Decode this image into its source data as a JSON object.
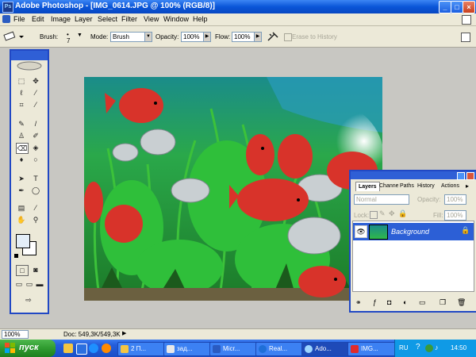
{
  "window": {
    "title": "Adobe Photoshop - [IMG_0614.JPG @ 100% (RGB/8)]",
    "controls": [
      "_",
      "□",
      "×"
    ]
  },
  "menu": [
    "File",
    "Edit",
    "Image",
    "Layer",
    "Select",
    "Filter",
    "View",
    "Window",
    "Help"
  ],
  "options": {
    "brush_label": "Brush:",
    "brush_size": "7",
    "mode_label": "Mode:",
    "mode_value": "Brush",
    "opacity_label": "Opacity:",
    "opacity_value": "100%",
    "flow_label": "Flow:",
    "flow_value": "100%",
    "erase_to_history": "Erase to History"
  },
  "layers_panel": {
    "tabs": [
      "Layers",
      "Channels",
      "Paths",
      "History",
      "Actions"
    ],
    "blend_mode": "Normal",
    "opacity_label": "Opacity:",
    "opacity_value": "100%",
    "lock_label": "Lock:",
    "fill_label": "Fill:",
    "fill_value": "100%",
    "layer_name": "Background"
  },
  "status": {
    "zoom": "100%",
    "doc": "Doc: 549,3K/549,3K"
  },
  "taskbar": {
    "start_label": "пуск",
    "tasks": [
      "2 П...",
      "зад...",
      "Micr...",
      "Real...",
      "Ado...",
      "IMG..."
    ],
    "language": "RU",
    "clock": "14:50"
  },
  "colors": {
    "title_blue": "#0a56d8",
    "panel_border": "#2148c4",
    "start_green": "#2f9a2f",
    "selected_layer": "#2c5fd6"
  }
}
